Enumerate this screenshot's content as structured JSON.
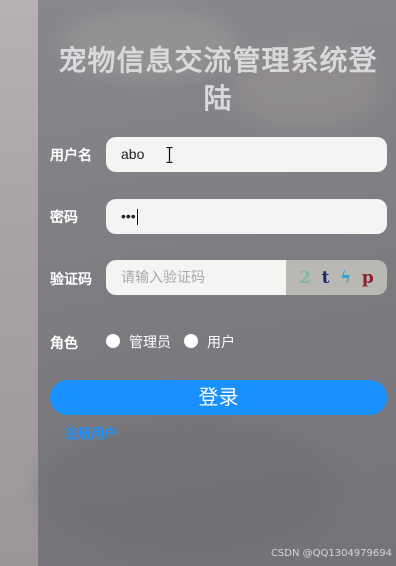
{
  "title": "宠物信息交流管理系统登陆",
  "form": {
    "username_label": "用户名",
    "username_value": "abo",
    "password_label": "密码",
    "password_value": "•••",
    "captcha_label": "验证码",
    "captcha_placeholder": "请输入验证码",
    "captcha_chars": [
      {
        "char": "2",
        "color": "#7fb7a6"
      },
      {
        "char": "t",
        "color": "#1c2a6b"
      },
      {
        "char": "ϟ",
        "color": "#2aa7d6"
      },
      {
        "char": "p",
        "color": "#8b1f2a"
      }
    ],
    "role_label": "角色",
    "role_options": [
      "管理员",
      "用户"
    ],
    "login_button": "登录",
    "register_link": "注册用户"
  },
  "watermark": "CSDN @QQ1304979694",
  "colors": {
    "primary": "#1890ff",
    "field_bg": "#f4f4f2"
  }
}
